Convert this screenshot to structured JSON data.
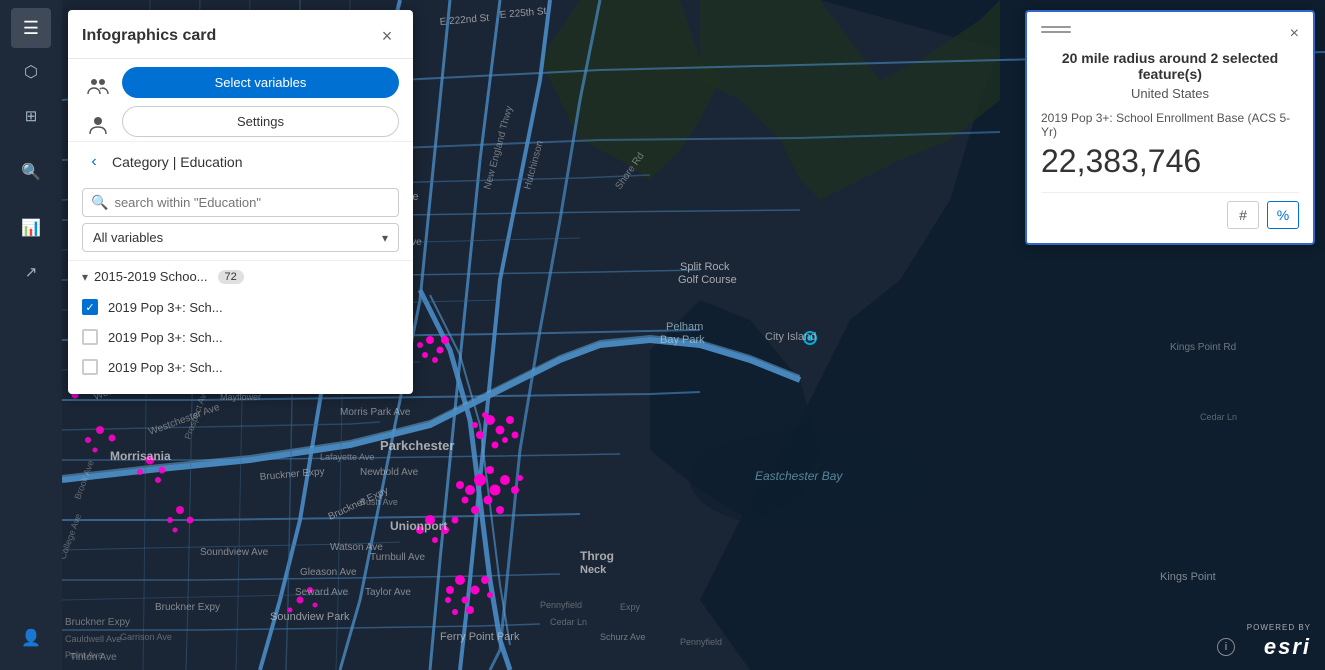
{
  "panel": {
    "title": "Infographics card",
    "close_label": "×",
    "select_variables_btn": "Select variables",
    "settings_btn": "Settings",
    "category_prefix": "Category | ",
    "category_name": "Education",
    "search_placeholder": "search within \"Education\"",
    "dropdown_label": "All variables",
    "group_label": "2015-2019 Schoo...",
    "group_count": "72",
    "items": [
      {
        "label": "2019 Pop 3+: Sch...",
        "checked": true
      },
      {
        "label": "2019 Pop 3+: Sch...",
        "checked": false
      },
      {
        "label": "2019 Pop 3+: Sch...",
        "checked": false
      }
    ]
  },
  "info_card": {
    "title": "20 mile radius around 2 selected feature(s)",
    "country": "United States",
    "stat_label": "2019 Pop 3+: School Enrollment Base (ACS 5-Yr)",
    "stat_value": "22,383,746",
    "hash_btn": "#",
    "percent_btn": "%",
    "close_label": "×"
  },
  "toolbar": {
    "items": [
      {
        "icon": "≡",
        "name": "menu"
      },
      {
        "icon": "⬡",
        "name": "layers"
      },
      {
        "icon": "⊞",
        "name": "grid"
      },
      {
        "icon": "🔍",
        "name": "search"
      },
      {
        "icon": "📊",
        "name": "chart"
      },
      {
        "icon": "↗",
        "name": "share"
      },
      {
        "icon": "👤",
        "name": "user"
      }
    ]
  },
  "esri": {
    "powered_by": "POWERED BY",
    "brand": "esri"
  }
}
